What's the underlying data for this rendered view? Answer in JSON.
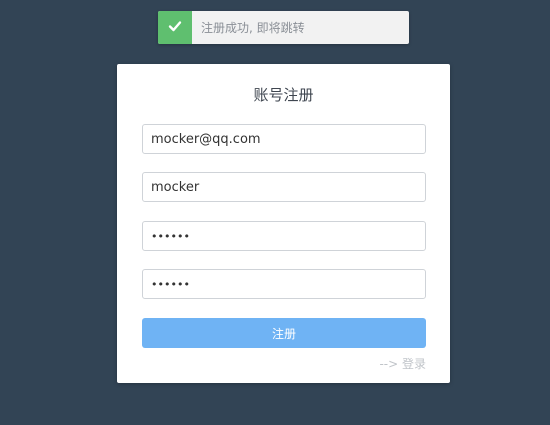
{
  "toast": {
    "icon": "check-icon",
    "message": "注册成功, 即将跳转",
    "colors": {
      "success": "#5fbf6f"
    }
  },
  "form": {
    "title": "账号注册",
    "email_value": "mocker@qq.com",
    "username_value": "mocker",
    "password_value": "••••••",
    "confirm_password_value": "••••••",
    "submit_label": "注册",
    "login_link_label": "--> 登录"
  },
  "colors": {
    "background": "#324455",
    "primary_button": "#6fb3f4"
  }
}
